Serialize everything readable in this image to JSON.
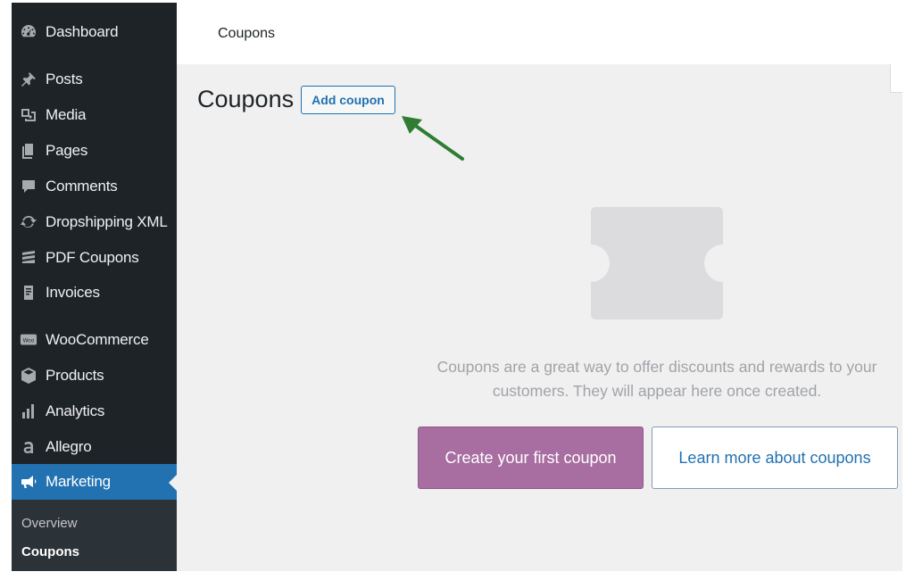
{
  "colors": {
    "sidebar_bg": "#1d2327",
    "active_bg": "#2271b1",
    "content_bg": "#f0f0f1",
    "primary_button": "#a86ea1",
    "link_blue": "#2271b1",
    "arrow_green": "#2e7d32"
  },
  "sidebar": {
    "items": [
      {
        "label": "Dashboard",
        "icon": "dashboard-icon"
      },
      {
        "label": "Posts",
        "icon": "pin-icon"
      },
      {
        "label": "Media",
        "icon": "media-icon"
      },
      {
        "label": "Pages",
        "icon": "pages-icon"
      },
      {
        "label": "Comments",
        "icon": "comment-icon"
      },
      {
        "label": "Dropshipping XML",
        "icon": "sync-icon"
      },
      {
        "label": "PDF Coupons",
        "icon": "stack-icon"
      },
      {
        "label": "Invoices",
        "icon": "invoice-icon"
      },
      {
        "label": "WooCommerce",
        "icon": "woo-icon"
      },
      {
        "label": "Products",
        "icon": "box-icon"
      },
      {
        "label": "Analytics",
        "icon": "bar-chart-icon"
      },
      {
        "label": "Allegro",
        "icon": "allegro-icon"
      },
      {
        "label": "Marketing",
        "icon": "megaphone-icon"
      }
    ],
    "submenu": [
      {
        "label": "Overview"
      },
      {
        "label": "Coupons"
      }
    ],
    "woo_badge": "Woo"
  },
  "header": {
    "breadcrumb": "Coupons"
  },
  "main": {
    "title": "Coupons",
    "add_button": "Add coupon",
    "empty_message_line1": "Coupons are a great way to offer discounts and rewards to your",
    "empty_message_line2": "customers. They will appear here once created.",
    "primary_cta": "Create your first coupon",
    "secondary_cta": "Learn more about coupons"
  }
}
